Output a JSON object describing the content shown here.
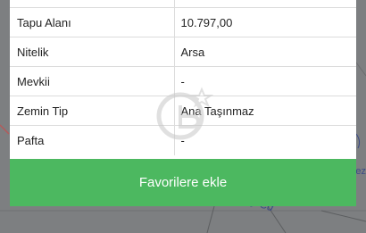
{
  "property_details": {
    "rows": [
      {
        "key": "Tapu Alanı",
        "value": "10.797,00"
      },
      {
        "key": "Nitelik",
        "value": "Arsa"
      },
      {
        "key": "Mevkii",
        "value": "-"
      },
      {
        "key": "Zemin Tip",
        "value": "Ana Taşınmaz"
      },
      {
        "key": "Pafta",
        "value": "-"
      }
    ]
  },
  "actions": {
    "favorite_label": "Favorilere ekle",
    "favorite_color": "#4cb860"
  },
  "map": {
    "road_label": "y Cd",
    "edge_label": "ez"
  },
  "watermark": {
    "icon": "brand-logo-watermark-icon"
  }
}
